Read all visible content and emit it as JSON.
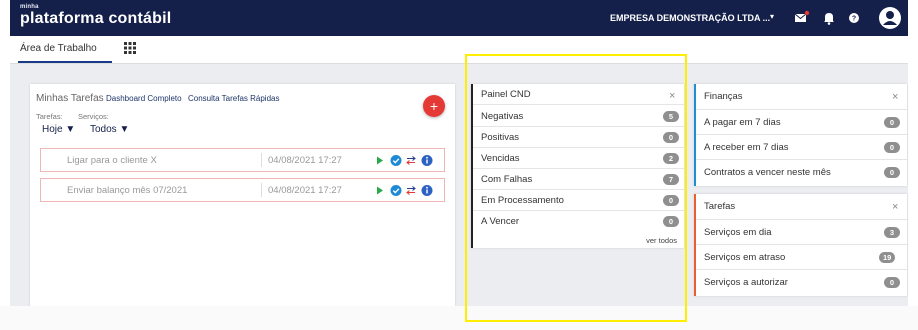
{
  "app": {
    "brand_small": "minha",
    "brand": "plataforma contábil"
  },
  "topbar": {
    "company": "EMPRESA DEMONSTRAÇÃO LTDA ...",
    "caret": "▾"
  },
  "tabs": {
    "home": "Área de Trabalho"
  },
  "minhas_tarefas": {
    "title": "Minhas Tarefas",
    "link_dashboard": "Dashboard Completo",
    "link_consulta": "Consulta Tarefas Rápidas",
    "label_tarefas": "Tarefas:",
    "label_servicos": "Serviços:",
    "sel_tarefas": "Hoje ▼",
    "sel_servicos": "Todos ▼",
    "add": "+",
    "tasks": [
      {
        "name": "Ligar para o cliente X",
        "date": "04/08/2021 17:27"
      },
      {
        "name": "Enviar balanço mês 07/2021",
        "date": "04/08/2021 17:27"
      }
    ]
  },
  "cnd": {
    "title": "Painel CND",
    "close": "×",
    "rows": [
      {
        "label": "Negativas",
        "count": "5"
      },
      {
        "label": "Positivas",
        "count": "0"
      },
      {
        "label": "Vencidas",
        "count": "2"
      },
      {
        "label": "Com Falhas",
        "count": "7"
      },
      {
        "label": "Em Processamento",
        "count": "0"
      },
      {
        "label": "A Vencer",
        "count": "0"
      }
    ],
    "ver_todos": "ver todos"
  },
  "financas": {
    "title": "Finanças",
    "close": "×",
    "rows": [
      {
        "label": "A pagar em 7 dias",
        "count": "0"
      },
      {
        "label": "A receber em 7 dias",
        "count": "0"
      },
      {
        "label": "Contratos a vencer neste mês",
        "count": "0"
      }
    ]
  },
  "tarefas": {
    "title": "Tarefas",
    "close": "×",
    "rows": [
      {
        "label": "Serviços em dia",
        "count": "3"
      },
      {
        "label": "Serviços em atraso",
        "count": "19"
      },
      {
        "label": "Serviços a autorizar",
        "count": "0"
      }
    ]
  },
  "colors": {
    "navbar": "#14204a",
    "cnd_accent": "#222222",
    "financas_accent": "#1e90cf",
    "tarefas_accent": "#e8602c",
    "fab": "#e53935",
    "highlight": "#ffee00"
  }
}
